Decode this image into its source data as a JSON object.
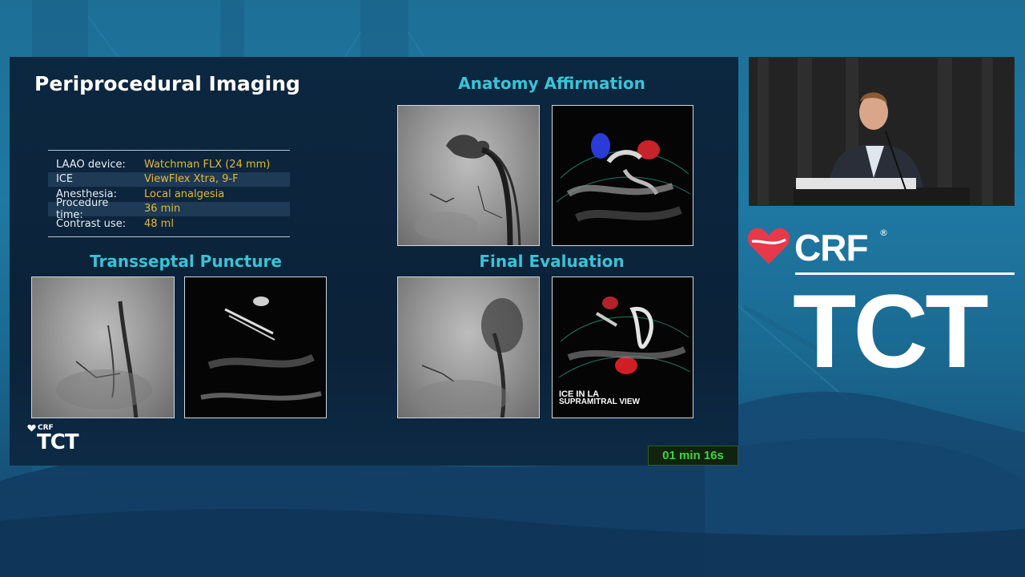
{
  "slide": {
    "title": "Periprocedural Imaging",
    "info_table": [
      {
        "label": "LAAO device:",
        "value": "Watchman FLX (24 mm)"
      },
      {
        "label": "ICE",
        "value": "ViewFlex Xtra, 9-F"
      },
      {
        "label": "Anesthesia:",
        "value": "Local analgesia"
      },
      {
        "label": "Procedure time:",
        "value": "36 min"
      },
      {
        "label": "Contrast use:",
        "value": "48 ml"
      }
    ],
    "sections": {
      "anatomy": "Anatomy Affirmation",
      "transseptal": "Transseptal Puncture",
      "final": "Final Evaluation"
    },
    "echo_label_line1": "ICE IN LA",
    "echo_label_line2": "SUPRAMITRAL VIEW",
    "logo": {
      "crf": "CRF",
      "tct": "TCT"
    }
  },
  "timer": "01 min 16s",
  "brand": {
    "crf": "CRF",
    "registered": "®",
    "tct": "TCT"
  },
  "colors": {
    "section_title": "#39c3d6",
    "info_value": "#e5b83b",
    "timer_text": "#3fd43a",
    "brand_heart": "#e8394a"
  },
  "icons": {
    "heart": "crf-heart-icon"
  }
}
